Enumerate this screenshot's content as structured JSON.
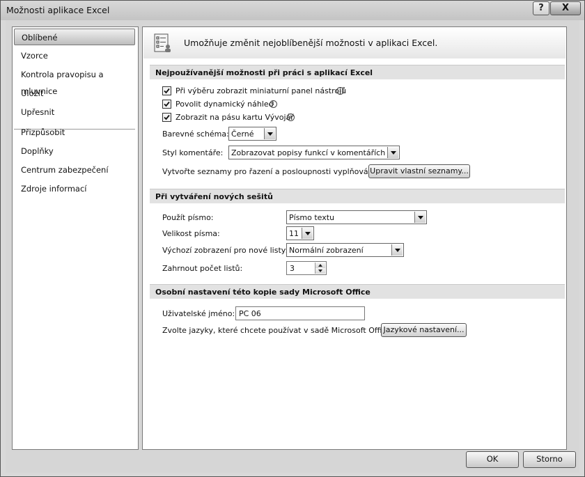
{
  "window": {
    "title": "Možnosti aplikace Excel",
    "help_glyph": "?",
    "close_glyph": "X"
  },
  "sidebar": {
    "items": [
      {
        "label": "Oblíbené"
      },
      {
        "label": "Vzorce"
      },
      {
        "label": "Kontrola pravopisu a mluvnice"
      },
      {
        "label": "Uložit"
      },
      {
        "label": "Upřesnit"
      },
      {
        "label": "Přizpůsobit"
      },
      {
        "label": "Doplňky"
      },
      {
        "label": "Centrum zabezpečení"
      },
      {
        "label": "Zdroje informací"
      }
    ]
  },
  "banner": {
    "text": "Umožňuje změnit nejoblíbenější možnosti v aplikaci Excel."
  },
  "section1": {
    "header": "Nejpoužívanější možnosti při práci s aplikací Excel",
    "checks": [
      {
        "label": "Při výběru zobrazit miniaturní panel nástrojů",
        "checked": true
      },
      {
        "label": "Povolit dynamický náhled",
        "checked": true
      },
      {
        "label": "Zobrazit na pásu kartu Vývojář",
        "checked": true
      }
    ],
    "color_scheme_label": "Barevné schéma:",
    "color_scheme_value": "Černé",
    "comment_style_label": "Styl komentáře:",
    "comment_style_value": "Zobrazovat popisy funkcí v komentářích",
    "lists_label": "Vytvořte seznamy pro řazení a posloupnosti vyplňování:",
    "lists_button": "Upravit vlastní seznamy..."
  },
  "section2": {
    "header": "Při vytváření nových sešitů",
    "font_label": "Použít písmo:",
    "font_value": "Písmo textu",
    "size_label": "Velikost písma:",
    "size_value": "11",
    "view_label": "Výchozí zobrazení pro nové listy:",
    "view_value": "Normální zobrazení",
    "sheets_label": "Zahrnout počet listů:",
    "sheets_value": "3"
  },
  "section3": {
    "header": "Osobní nastavení této kopie sady Microsoft Office",
    "username_label": "Uživatelské jméno:",
    "username_value": "PC 06",
    "languages_label": "Zvolte jazyky, které chcete používat v sadě Microsoft Office:",
    "languages_button": "Jazykové nastavení..."
  },
  "footer": {
    "ok": "OK",
    "cancel": "Storno"
  },
  "info_glyph": "i"
}
